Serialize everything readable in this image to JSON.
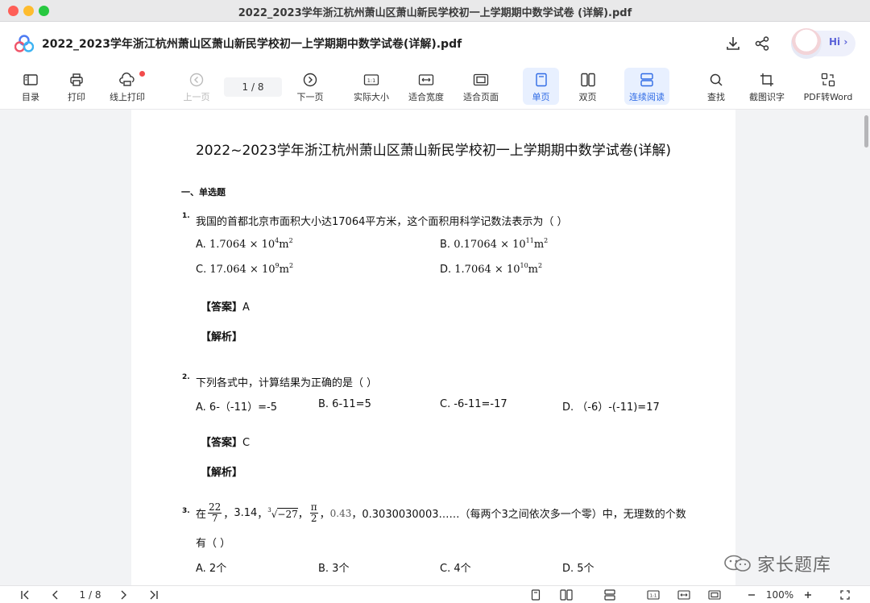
{
  "window": {
    "title": "2022_2023学年浙江杭州萧山区萧山新民学校初一上学期期中数学试卷 (详解).pdf"
  },
  "header": {
    "doc_title": "2022_2023学年浙江杭州萧山区萧山新民学校初一上学期期中数学试卷(详解).pdf",
    "avatar_label": "Hi ›",
    "icons": [
      "download-icon",
      "share-icon"
    ]
  },
  "toolbar": {
    "toc": "目录",
    "print": "打印",
    "online_print": "线上打印",
    "prev_page": "上一页",
    "page_indicator": "1  /  8",
    "next_page": "下一页",
    "actual_size": "实际大小",
    "fit_width": "适合宽度",
    "fit_page": "适合页面",
    "single_page": "单页",
    "double_page": "双页",
    "continuous": "连续阅读",
    "search": "查找",
    "ocr": "截图识字",
    "pdf_to_word": "PDF转Word",
    "active_color": "#2f6be5"
  },
  "document": {
    "title": "2022~2023学年浙江杭州萧山区萧山新民学校初一上学期期中数学试卷(详解)",
    "section": "一、单选题",
    "q1": {
      "num": "1.",
      "text": "我国的首都北京市面积大小达17064平方米，这个面积用科学记数法表示为（        ）",
      "a_label": "A. ",
      "a_coef": "1.7064",
      "a_exp": "4",
      "b_label": "B. ",
      "b_coef": "0.17064",
      "b_exp": "11",
      "c_label": "C. ",
      "c_coef": "17.064",
      "c_exp": "9",
      "d_label": "D. ",
      "d_coef": "1.7064",
      "d_exp": "10",
      "times": " × 10",
      "unit": "m",
      "unit_exp": "2",
      "answer_label": "【答案】",
      "answer": "A",
      "analysis_label": "【解析】"
    },
    "q2": {
      "num": "2.",
      "text": "下列各式中，计算结果为正确的是（        ）",
      "a": "A. 6-（-11）=-5",
      "b": "B. 6-11=5",
      "c": "C. -6-11=-17",
      "d": "D. （-6）-(-11)=17",
      "answer_label": "【答案】",
      "answer": "C",
      "analysis_label": "【解析】"
    },
    "q3": {
      "num": "3.",
      "prefix": "在",
      "frac1_num": "22",
      "frac1_den": "7",
      "sep": "，",
      "v2": "3.14",
      "root_index": "3",
      "root_body": "−27",
      "frac2_num": "π",
      "frac2_den": "2",
      "v5": "0.43̇",
      "rest": "，0.3030030003……（每两个3之间依次多一个零）中，无理数的个数",
      "line2": "有（        ）",
      "a": "A. 2个",
      "b": "B. 3个",
      "c": "C. 4个",
      "d": "D. 5个"
    }
  },
  "watermark": {
    "text": "家长题库"
  },
  "statusbar": {
    "page_indicator": "1  /  8",
    "zoom": "100%"
  }
}
